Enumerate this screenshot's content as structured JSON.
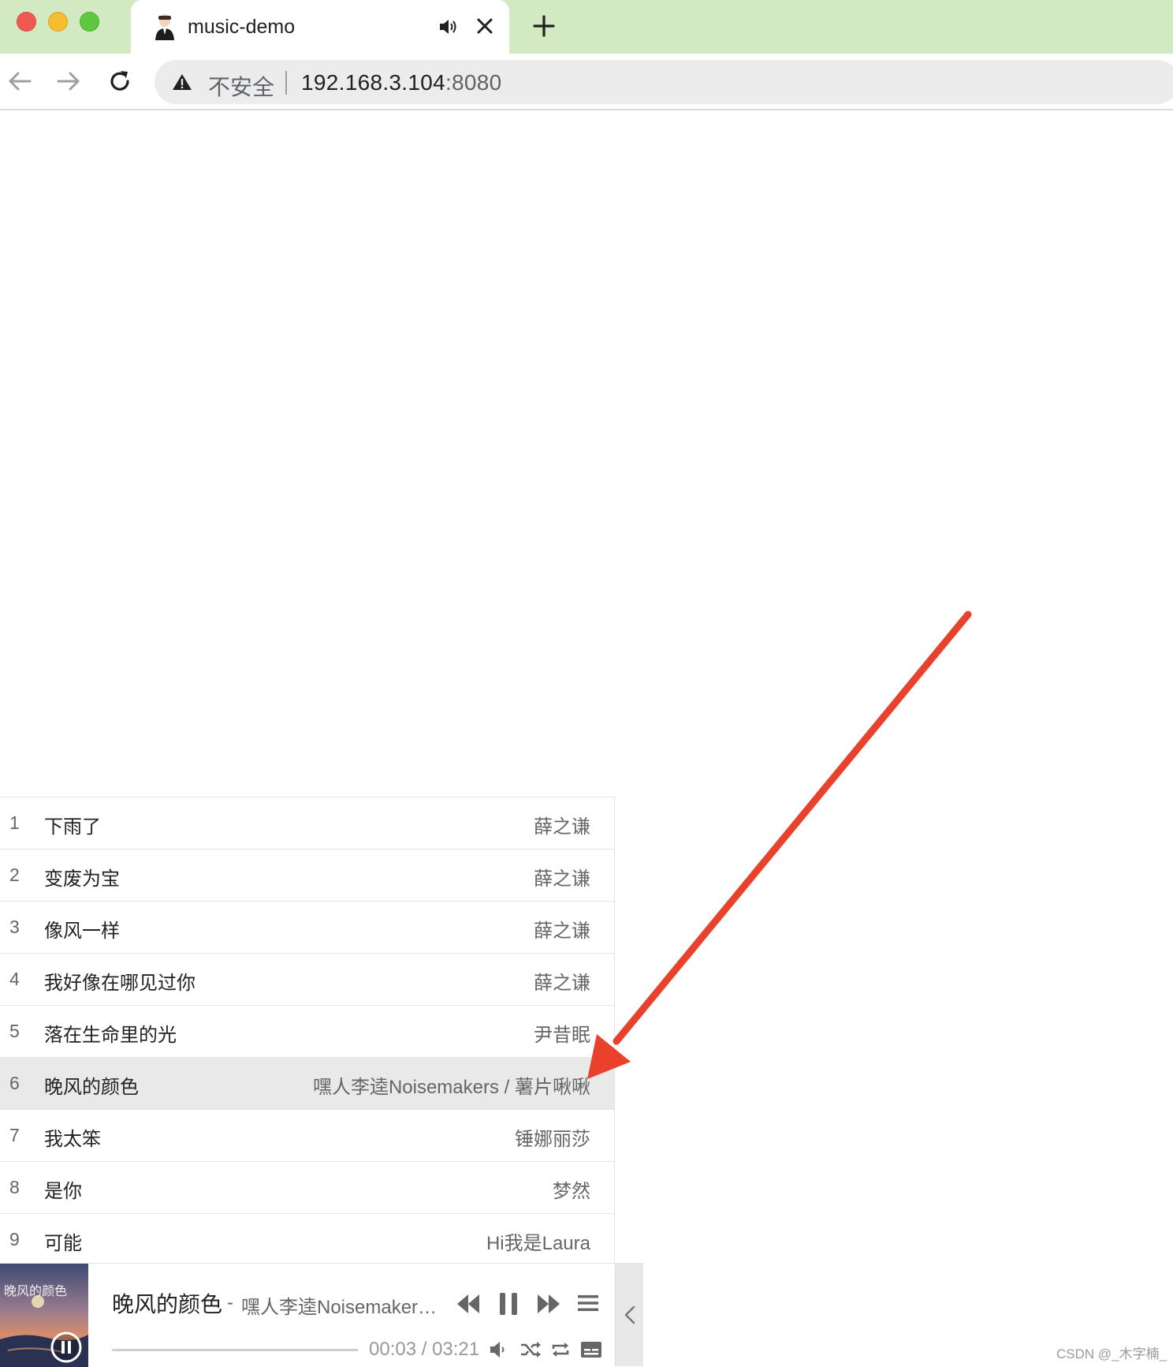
{
  "browser": {
    "tab": {
      "title": "music-demo",
      "favicon": "avatar-icon",
      "audio_icon": "speaker-icon",
      "close_icon": "close-icon"
    },
    "new_tab_icon": "plus-icon",
    "nav": {
      "back_icon": "arrow-left-icon",
      "forward_icon": "arrow-right-icon",
      "reload_icon": "reload-icon"
    },
    "address_bar": {
      "security_icon": "warning-icon",
      "security_label": "不安全",
      "host": "192.168.3.104",
      "port": ":8080"
    }
  },
  "playlist": {
    "active_index": 6,
    "songs": [
      {
        "index": "1",
        "title": "下雨了",
        "artist": "薛之谦"
      },
      {
        "index": "2",
        "title": "变废为宝",
        "artist": "薛之谦"
      },
      {
        "index": "3",
        "title": "像风一样",
        "artist": "薛之谦"
      },
      {
        "index": "4",
        "title": "我好像在哪见过你",
        "artist": "薛之谦"
      },
      {
        "index": "5",
        "title": "落在生命里的光",
        "artist": "尹昔眠"
      },
      {
        "index": "6",
        "title": "晚风的颜色",
        "artist": "嘿人李逵Noisemakers / 薯片啾啾"
      },
      {
        "index": "7",
        "title": "我太笨",
        "artist": "锤娜丽莎"
      },
      {
        "index": "8",
        "title": "是你",
        "artist": "梦然"
      },
      {
        "index": "9",
        "title": "可能",
        "artist": "Hi我是Laura"
      }
    ]
  },
  "player": {
    "cover_text": "晚风的颜色",
    "title": "晚风的颜色",
    "separator": "-",
    "artist": "嘿人李逵Noisemakers / 薯片啾啾",
    "time": "00:03 / 03:21",
    "progress_fraction": 0.015,
    "icons": [
      "prev-icon",
      "pause-icon",
      "next-icon",
      "menu-icon",
      "volume-icon",
      "shuffle-icon",
      "loop-icon",
      "lyrics-icon",
      "chevron-left-icon"
    ]
  },
  "colors": {
    "tabbar": "#d3e9c2",
    "arrow": "#e8412c",
    "active_row": "#e9e9e9"
  },
  "watermark": "CSDN @_木字楠_"
}
